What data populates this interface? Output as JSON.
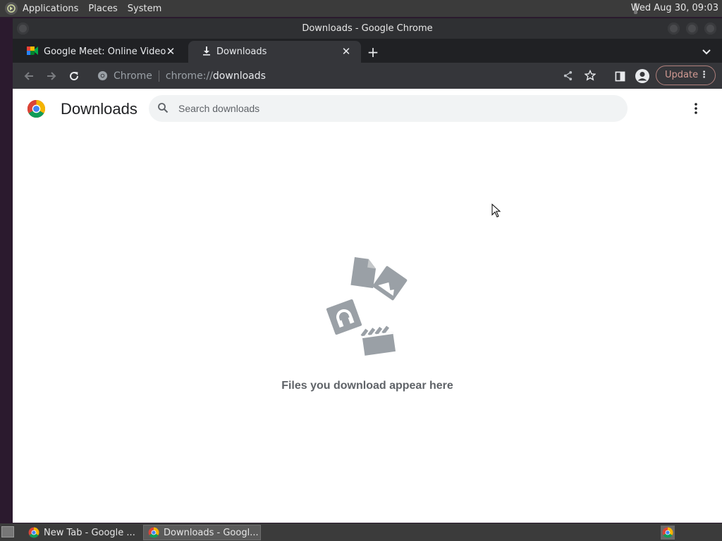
{
  "top_panel": {
    "menus": [
      "Applications",
      "Places",
      "System"
    ],
    "clock": "Wed Aug 30, 09:03"
  },
  "window": {
    "title": "Downloads - Google Chrome",
    "tabs": [
      {
        "label": "Google Meet: Online Video Meeting",
        "icon": "google-meet-icon",
        "active": false
      },
      {
        "label": "Downloads",
        "icon": "download-icon",
        "active": true
      }
    ],
    "toolbar": {
      "site_label": "Chrome",
      "url_scheme": "chrome://",
      "url_path": "downloads",
      "update_label": "Update"
    }
  },
  "page": {
    "title": "Downloads",
    "search_placeholder": "Search downloads",
    "empty_message": "Files you download appear here"
  },
  "taskbar": {
    "items": [
      {
        "label": "New Tab - Google ...",
        "active": false
      },
      {
        "label": "Downloads - Googl...",
        "active": true
      }
    ]
  },
  "colors": {
    "panel": "#3b3b3b",
    "chrome_frame": "#202124",
    "chrome_toolbar": "#35363a",
    "update_accent": "#d39b94",
    "empty_art": "#9aa0a6"
  }
}
